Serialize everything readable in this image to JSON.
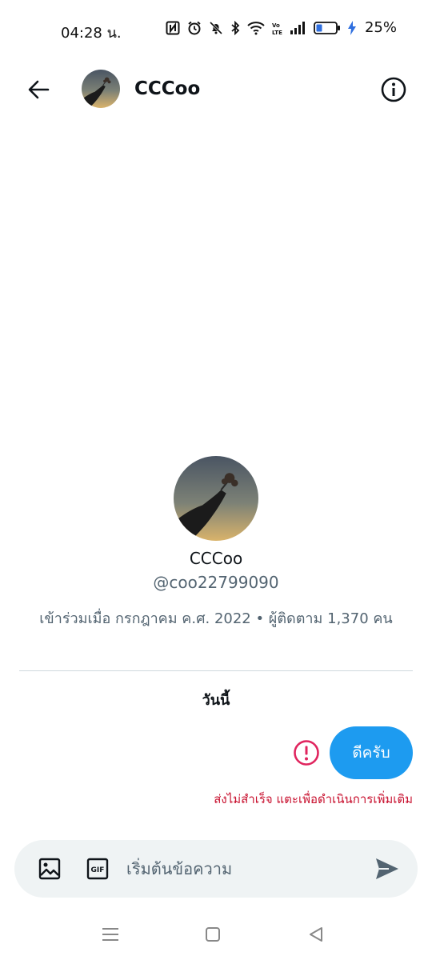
{
  "status_bar": {
    "time": "04:28 น.",
    "battery_percent": "25%"
  },
  "header": {
    "title": "CCCoo"
  },
  "profile": {
    "name": "CCCoo",
    "handle": "@coo22799090",
    "meta": "เข้าร่วมเมื่อ กรกฎาคม ค.ศ. 2022 • ผู้ติดตาม 1,370 คน"
  },
  "conversation": {
    "date_label": "วันนี้",
    "messages": [
      {
        "text": "ดีครับ",
        "error": "ส่งไม่สำเร็จ แตะเพื่อดำเนินการเพิ่มเติม"
      }
    ]
  },
  "composer": {
    "placeholder": "เริ่มต้นข้อความ"
  },
  "colors": {
    "accent": "#1d9bf0",
    "error": "#c8102e",
    "secondary_text": "#536471",
    "composer_bg": "#eff3f4"
  },
  "icons": {
    "back": "arrow-left-icon",
    "info": "info-icon",
    "error": "alert-circle-icon",
    "image": "image-icon",
    "gif": "gif-icon",
    "send": "send-icon"
  }
}
